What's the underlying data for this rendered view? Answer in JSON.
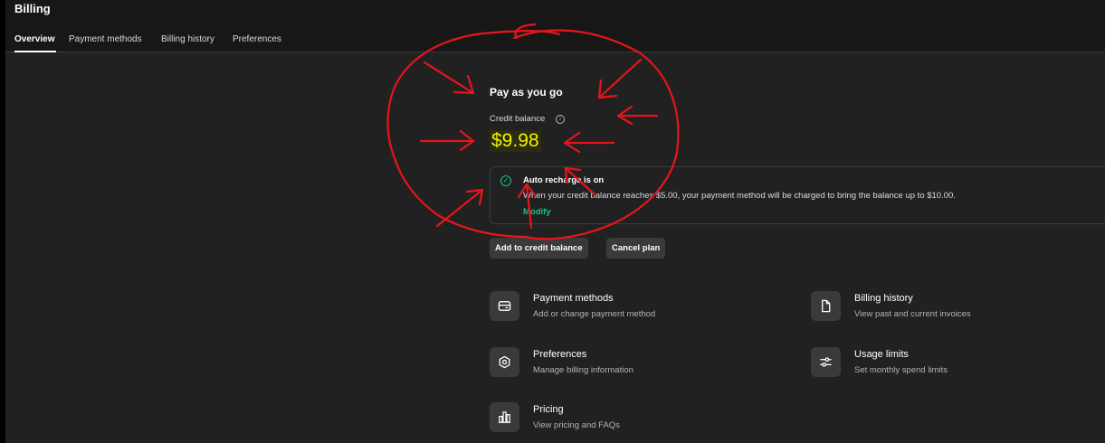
{
  "header": {
    "title": "Billing"
  },
  "tabs": [
    {
      "label": "Overview",
      "active": true
    },
    {
      "label": "Payment methods",
      "active": false
    },
    {
      "label": "Billing history",
      "active": false
    },
    {
      "label": "Preferences",
      "active": false
    }
  ],
  "plan": {
    "title": "Pay as you go",
    "balance_label": "Credit balance",
    "balance_value": "$9.98"
  },
  "auto_recharge": {
    "title": "Auto recharge is on",
    "description": "When your credit balance reaches $5.00, your payment method will be charged to bring the balance up to $10.00.",
    "modify_label": "Modify"
  },
  "actions": {
    "add_credit_label": "Add to credit balance",
    "cancel_plan_label": "Cancel plan"
  },
  "cards": [
    {
      "title": "Payment methods",
      "subtitle": "Add or change payment method",
      "icon": "credit-card-icon"
    },
    {
      "title": "Billing history",
      "subtitle": "View past and current invoices",
      "icon": "document-icon"
    },
    {
      "title": "Preferences",
      "subtitle": "Manage billing information",
      "icon": "gear-icon"
    },
    {
      "title": "Usage limits",
      "subtitle": "Set monthly spend limits",
      "icon": "sliders-icon"
    },
    {
      "title": "Pricing",
      "subtitle": "View pricing and FAQs",
      "icon": "pricing-chart-icon"
    }
  ],
  "colors": {
    "accent": "#19c37d",
    "balance_highlight": "#f2f200",
    "annotation": "#e8141c",
    "background": "#212121"
  }
}
